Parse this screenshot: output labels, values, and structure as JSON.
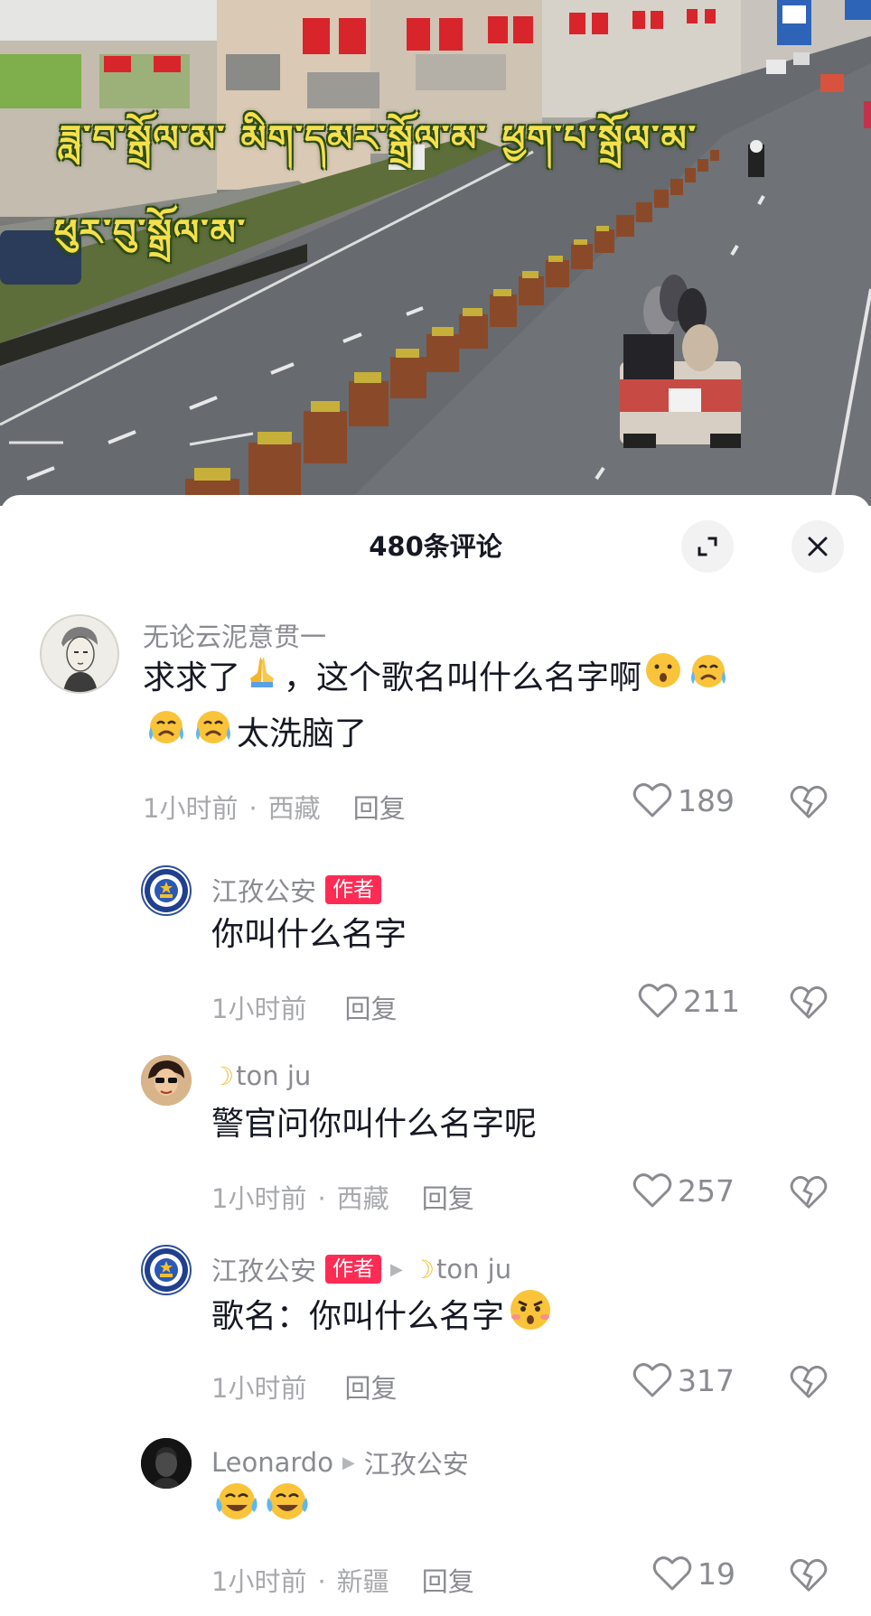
{
  "video": {
    "overlay_line1": "ཟླ་བ་སྒྲོལ་མ་  མིག་དམར་སྒྲོལ་མ་  ཕྱག་པ་སྒྲོལ་མ་",
    "overlay_line2": "ཕུར་བུ་སྒྲོལ་མ་"
  },
  "sheet": {
    "title": "480条评论",
    "expand_icon": "expand-icon",
    "close_icon": "close-icon"
  },
  "comments": [
    {
      "username": "无论云泥意贯一",
      "text_a": "求求了",
      "text_b": "，这个歌名叫什么名字啊",
      "text_c": "太洗脑了",
      "time": "1小时前",
      "location": "西藏",
      "reply_label": "回复",
      "likes": "189"
    },
    {
      "username": "江孜公安",
      "badge": "作者",
      "text": "你叫什么名字",
      "time": "1小时前",
      "reply_label": "回复",
      "likes": "211"
    },
    {
      "username": "ton ju",
      "text": "警官问你叫什么名字呢",
      "time": "1小时前",
      "location": "西藏",
      "reply_label": "回复",
      "likes": "257"
    },
    {
      "username": "江孜公安",
      "badge": "作者",
      "reply_to": "ton ju",
      "text": "歌名：你叫什么名字",
      "time": "1小时前",
      "reply_label": "回复",
      "likes": "317"
    },
    {
      "username": "Leonardo",
      "reply_to": "江孜公安",
      "text": "",
      "time": "1小时前",
      "location": "新疆",
      "reply_label": "回复",
      "likes": "19"
    }
  ],
  "colors": {
    "accent": "#fe2c55",
    "overlay_text": "#f4e04d"
  }
}
